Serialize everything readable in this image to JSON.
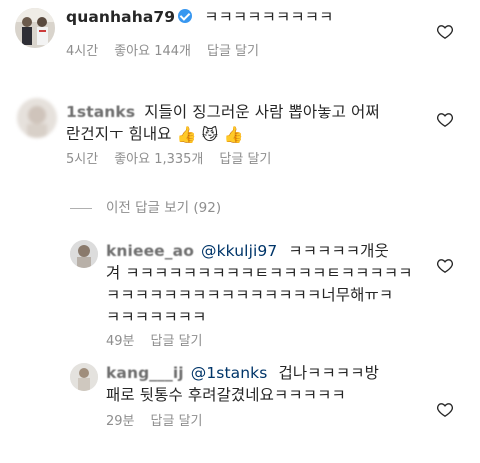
{
  "comment1": {
    "username": "quanhaha79",
    "verified": true,
    "text": "ㅋㅋㅋㅋㅋㅋㅋㅋㅋ",
    "time": "4시간",
    "likes": "좋아요 144개",
    "reply": "답글 달기"
  },
  "comment2": {
    "username": "1stanks",
    "text_line1": "지들이 징그러운 사람 뽑아놓고 어쩌",
    "text_line2": "란건지ㅜ 힘내요",
    "emoji1": "👍",
    "emoji2": "😼",
    "emoji3": "👍",
    "time": "5시간",
    "likes": "좋아요 1,335개",
    "reply": "답글 달기"
  },
  "view_previous": "이전 답글 보기 (92)",
  "reply1": {
    "username": "knieee_ao",
    "mention": "@kkulji97",
    "text_line1_suffix": "ㅋㅋㅋㅋㅋ개웃",
    "text_line2": "겨 ㅋㅋㅋㅋㅋㅋㅋㅋㅋㅌㅋㅋㅋㅋㅌㅋㅋㅋㅋㅋ",
    "text_line3": "ㅋㅋㅋㅋㅋㅋㅋㅋㅋㅋㅋㅋㅋㅋㅋ너무해ㅠㅋ",
    "text_line4": "ㅋㅋㅋㅋㅋㅋㅋ",
    "time": "49분",
    "reply": "답글 달기"
  },
  "reply2": {
    "username": "kang___ij",
    "mention": "@1stanks",
    "text_line1_suffix": "겁나ㅋㅋㅋㅋ방",
    "text_line2": "패로 뒷통수 후려갈겼네요ㅋㅋㅋㅋㅋ",
    "time": "29분",
    "reply": "답글 달기"
  },
  "colors": {
    "text": "#262626",
    "meta": "#8e8e8e",
    "verified": "#3897f0",
    "mention": "#003569"
  },
  "icons": {
    "like": "heart-outline-icon"
  }
}
